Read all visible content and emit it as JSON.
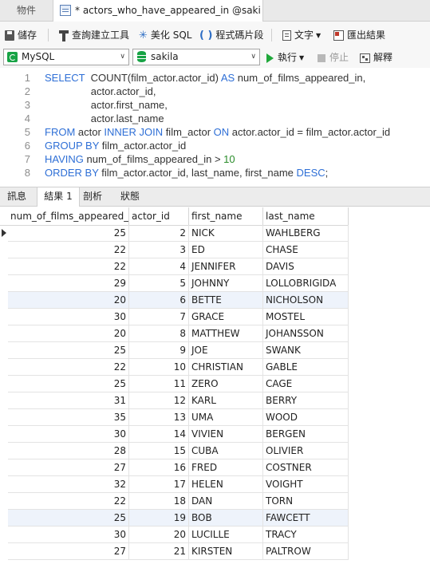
{
  "tabs": {
    "objects": "物件",
    "query": "* actors_who_have_appeared_in @sakila ..."
  },
  "toolbar": {
    "save": "儲存",
    "query_builder": "查詢建立工具",
    "beautify_sql": "美化 SQL",
    "code_snippet": "程式碼片段",
    "text": "文字",
    "export_result": "匯出結果"
  },
  "connection": {
    "server": "MySQL",
    "database": "sakila",
    "run": "執行",
    "stop": "停止",
    "explain": "解釋"
  },
  "editor": {
    "line_numbers": [
      "1",
      "2",
      "3",
      "4",
      "5",
      "6",
      "7",
      "8"
    ]
  },
  "result_tabs": [
    "訊息",
    "結果 1",
    "剖析",
    "狀態"
  ],
  "grid": {
    "columns": [
      "num_of_films_appeared_in",
      "actor_id",
      "first_name",
      "last_name"
    ],
    "rows": [
      [
        "25",
        "2",
        "NICK",
        "WAHLBERG"
      ],
      [
        "22",
        "3",
        "ED",
        "CHASE"
      ],
      [
        "22",
        "4",
        "JENNIFER",
        "DAVIS"
      ],
      [
        "29",
        "5",
        "JOHNNY",
        "LOLLOBRIGIDA"
      ],
      [
        "20",
        "6",
        "BETTE",
        "NICHOLSON"
      ],
      [
        "30",
        "7",
        "GRACE",
        "MOSTEL"
      ],
      [
        "20",
        "8",
        "MATTHEW",
        "JOHANSSON"
      ],
      [
        "25",
        "9",
        "JOE",
        "SWANK"
      ],
      [
        "22",
        "10",
        "CHRISTIAN",
        "GABLE"
      ],
      [
        "25",
        "11",
        "ZERO",
        "CAGE"
      ],
      [
        "31",
        "12",
        "KARL",
        "BERRY"
      ],
      [
        "35",
        "13",
        "UMA",
        "WOOD"
      ],
      [
        "30",
        "14",
        "VIVIEN",
        "BERGEN"
      ],
      [
        "28",
        "15",
        "CUBA",
        "OLIVIER"
      ],
      [
        "27",
        "16",
        "FRED",
        "COSTNER"
      ],
      [
        "32",
        "17",
        "HELEN",
        "VOIGHT"
      ],
      [
        "22",
        "18",
        "DAN",
        "TORN"
      ],
      [
        "25",
        "19",
        "BOB",
        "FAWCETT"
      ],
      [
        "30",
        "20",
        "LUCILLE",
        "TRACY"
      ],
      [
        "27",
        "21",
        "KIRSTEN",
        "PALTROW"
      ]
    ]
  }
}
